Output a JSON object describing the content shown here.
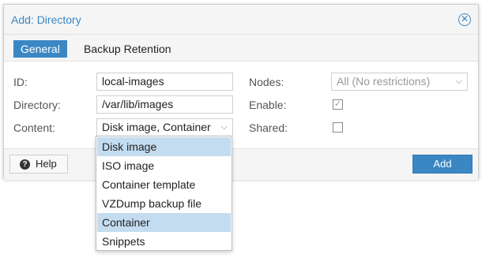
{
  "dialog": {
    "title": "Add: Directory",
    "close_icon": "close-circle-icon"
  },
  "tabs": [
    {
      "label": "General",
      "active": true
    },
    {
      "label": "Backup Retention",
      "active": false
    }
  ],
  "form": {
    "id_label": "ID:",
    "id_value": "local-images",
    "directory_label": "Directory:",
    "directory_value": "/var/lib/images",
    "content_label": "Content:",
    "content_value": "Disk image, Container",
    "nodes_label": "Nodes:",
    "nodes_value": "All (No restrictions)",
    "enable_label": "Enable:",
    "enable_checked": true,
    "shared_label": "Shared:",
    "shared_checked": false
  },
  "footer": {
    "help_label": "Help",
    "add_label": "Add"
  },
  "content_options": [
    {
      "label": "Disk image",
      "selected": true
    },
    {
      "label": "ISO image",
      "selected": false
    },
    {
      "label": "Container template",
      "selected": false
    },
    {
      "label": "VZDump backup file",
      "selected": false
    },
    {
      "label": "Container",
      "selected": true
    },
    {
      "label": "Snippets",
      "selected": false
    }
  ],
  "colors": {
    "accent": "#3a87c4",
    "selected_option": "#c3dcf0"
  }
}
